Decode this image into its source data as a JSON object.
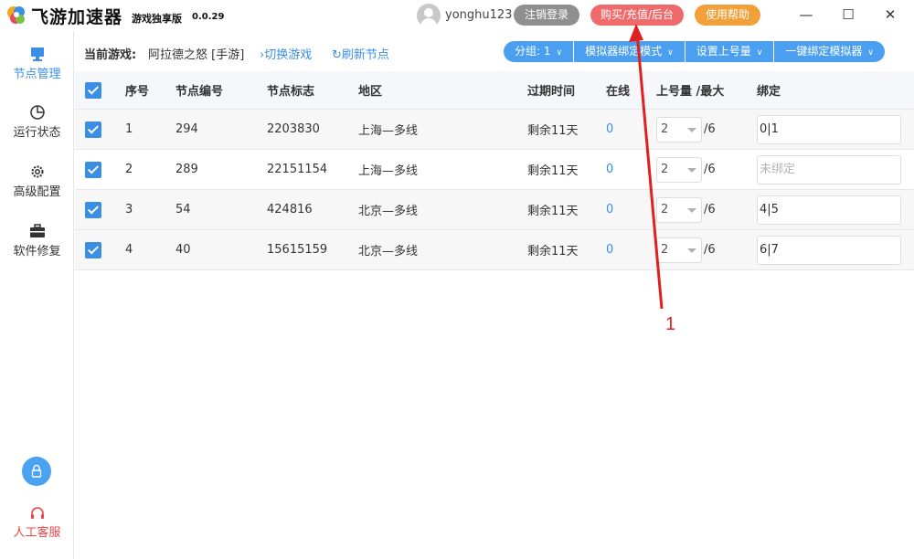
{
  "app": {
    "name": "飞游加速器",
    "edition": "游戏独享版",
    "version": "0.0.29"
  },
  "user": {
    "username": "yonghu123",
    "logout_label": "注销登录",
    "buy_label": "购买/充值/后台",
    "help_label": "使用帮助"
  },
  "window_controls": {
    "minimize": "—",
    "maximize": "☐",
    "close": "✕"
  },
  "sidebar": {
    "items": [
      {
        "label": "节点管理",
        "icon": "monitor-icon",
        "active": true
      },
      {
        "label": "运行状态",
        "icon": "pie-chart-icon",
        "active": false
      },
      {
        "label": "高级配置",
        "icon": "gear-icon",
        "active": false
      },
      {
        "label": "软件修复",
        "icon": "toolbox-icon",
        "active": false
      }
    ],
    "support_label": "人工客服"
  },
  "infobar": {
    "current_game_label": "当前游戏:",
    "current_game": "阿拉德之怒 [手游]",
    "switch_game": "切换游戏",
    "refresh_nodes": "刷新节点",
    "toolbar": {
      "group": "分组: 1",
      "emu_mode": "模拟器绑定模式",
      "set_quota": "设置上号量",
      "bind_all": "一键绑定模拟器"
    }
  },
  "table": {
    "headers": {
      "idx": "序号",
      "node": "节点编号",
      "tag": "节点标志",
      "region": "地区",
      "expire": "过期时间",
      "online": "在线",
      "quota": "上号量 /最大",
      "bind": "绑定"
    },
    "rows": [
      {
        "idx": "1",
        "node": "294",
        "tag": "2203830",
        "region": "上海—多线",
        "expire": "剩余11天",
        "online": "0",
        "quota": "2",
        "max": "/6",
        "bind": "0|1"
      },
      {
        "idx": "2",
        "node": "289",
        "tag": "22151154",
        "region": "上海—多线",
        "expire": "剩余11天",
        "online": "0",
        "quota": "2",
        "max": "/6",
        "bind": ""
      },
      {
        "idx": "3",
        "node": "54",
        "tag": "424816",
        "region": "北京—多线",
        "expire": "剩余11天",
        "online": "0",
        "quota": "2",
        "max": "/6",
        "bind": "4|5"
      },
      {
        "idx": "4",
        "node": "40",
        "tag": "15615159",
        "region": "北京—多线",
        "expire": "剩余11天",
        "online": "0",
        "quota": "2",
        "max": "/6",
        "bind": "6|7"
      }
    ],
    "bind_placeholder": "未绑定"
  },
  "annotation": {
    "label": "1"
  },
  "colors": {
    "accent": "#3a8ee6",
    "buy": "#ef6a6a",
    "help": "#f2a03a",
    "logout": "#8f8f8f",
    "annotation": "#e02020"
  }
}
